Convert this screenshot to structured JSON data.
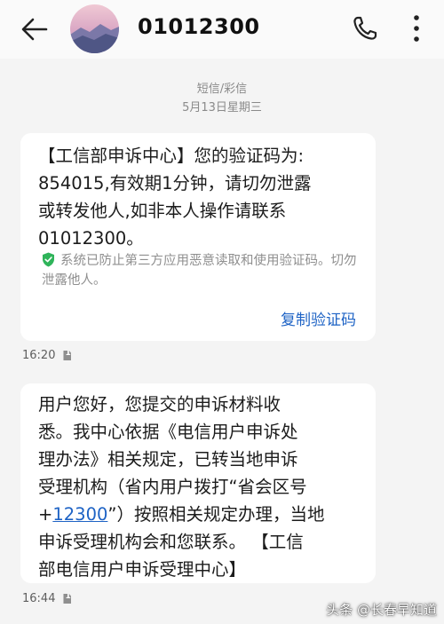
{
  "header": {
    "contact": "01012300",
    "back_icon": "arrow-left-icon",
    "phone_icon": "phone-icon",
    "more_icon": "more-vertical-icon"
  },
  "meta": {
    "type_label": "短信/彩信",
    "date_label": "5月13日星期三"
  },
  "messages": [
    {
      "text": "【工信部申诉中心】您的验证码为:\n854015,有效期1分钟，请切勿泄露\n或转发他人,如非本人操作请联系\n01012300。",
      "notice": "系统已防止第三方应用恶意读取和使用验证码。切勿泄露他人。",
      "action": "复制验证码",
      "time": "16:20"
    },
    {
      "text_before": "用户您好，您提交的申诉材料收\n悉。我中心依据《电信用户申诉处\n理办法》相关规定，已转当地申诉\n受理机构（省内用户拨打“省会区号\n+",
      "link": "12300",
      "text_after": "”）按照相关规定办理，当地\n申诉受理机构会和您联系。 【工信\n部电信用户申诉受理中心】",
      "time": "16:44"
    }
  ],
  "watermark": "头条 @长春早知道",
  "colors": {
    "link": "#1e63c5",
    "shield": "#2fb45a",
    "background": "#f4f4f4",
    "bubble": "#ffffff"
  }
}
